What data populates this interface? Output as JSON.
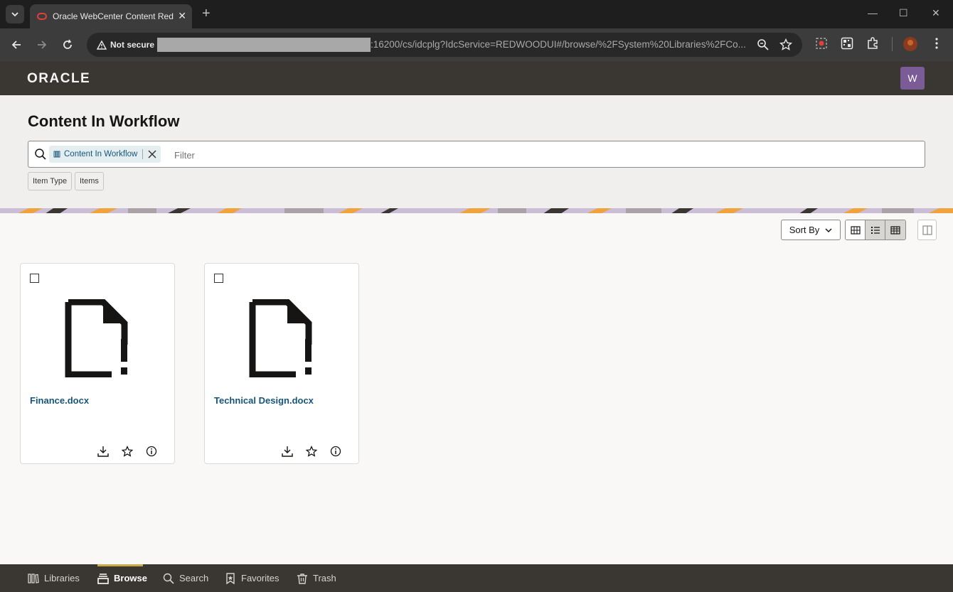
{
  "browser": {
    "tab_title": "Oracle WebCenter Content Redwood",
    "security_label": "Not secure",
    "url_visible": ":16200/cs/idcplg?IdcService=REDWOODUI#/browse/%2FSystem%20Libraries%2FCo..."
  },
  "app": {
    "brand": "ORACLE",
    "avatar_initial": "W"
  },
  "page": {
    "title": "Content In Workflow",
    "filter_chip": "Content In Workflow",
    "filter_placeholder": "Filter",
    "facets": [
      "Item Type",
      "Items"
    ]
  },
  "toolbar": {
    "sort_label": "Sort By"
  },
  "items": [
    {
      "name": "Finance.docx"
    },
    {
      "name": "Technical Design.docx"
    }
  ],
  "bottom_nav": [
    {
      "label": "Libraries",
      "icon": "libraries-icon"
    },
    {
      "label": "Browse",
      "icon": "browse-icon",
      "active": true
    },
    {
      "label": "Search",
      "icon": "search-icon"
    },
    {
      "label": "Favorites",
      "icon": "favorites-icon"
    },
    {
      "label": "Trash",
      "icon": "trash-icon"
    }
  ],
  "colors": {
    "header_bg": "#3a3631",
    "link": "#16557a",
    "avatar": "#7c5c96",
    "active_indicator": "#c9a94a"
  }
}
